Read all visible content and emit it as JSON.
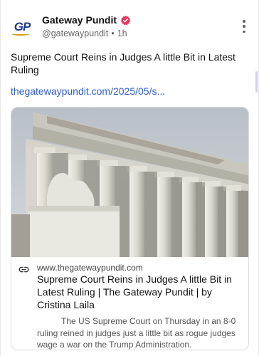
{
  "post": {
    "author": {
      "display_name": "Gateway Pundit",
      "handle": "@gatewaypundit",
      "time_sep": "•",
      "time": "1h",
      "avatar_text": "GP"
    },
    "text": "Supreme Court Reins in Judges A little Bit in Latest Ruling",
    "link": "thegatewaypundit.com/2025/05/s...",
    "card": {
      "domain": "www.thegatewaypundit.com",
      "title": "Supreme Court Reins in Judges A little Bit in Latest Ruling | The Gateway Pundit | by Cristina Laila",
      "description": "The US Supreme Court on Thursday in an 8-0 ruling reined in judges just a little bit as rogue judges wage a war on the Trump Administration."
    }
  },
  "icons": {
    "verified": "verified-badge-icon",
    "more": "more-vertical-icon",
    "link": "link-icon"
  },
  "colors": {
    "link": "#2d5bd7",
    "verified": "#e8365d",
    "avatar_text": "#1f3b8c"
  }
}
